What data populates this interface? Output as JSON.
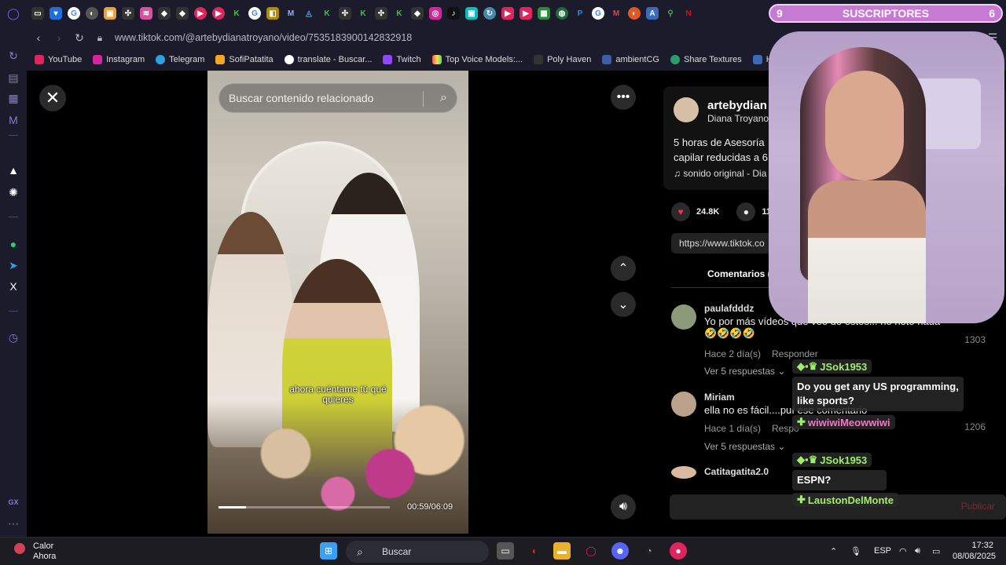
{
  "browser": {
    "url": "www.tiktok.com/@artebydianatroyano/video/7535183900142832918",
    "bookmarks": [
      "YouTube",
      "Instagram",
      "Telegram",
      "SofiPatatita",
      "translate - Buscar...",
      "Twitch",
      "Top Voice Models:...",
      "Poly Haven",
      "ambientCG",
      "Share Textures",
      "Ha"
    ]
  },
  "video": {
    "search_placeholder": "Buscar contenido relacionado",
    "subtitle": "ahora cuéntame tú qué\nquieres",
    "time": "00:59/06:09",
    "progress": 0.16
  },
  "post": {
    "username": "artebydian",
    "nickname": "Diana Troyano",
    "description_line1": "5 horas de Asesoría",
    "description_line2": "capilar reducidas a 6",
    "sound": "sonido original - Dia",
    "likes": "24.8K",
    "comments_count": "117",
    "link": "https://www.tiktok.co",
    "comments_tab": "Comentarios ("
  },
  "comments": [
    {
      "name": "paulafdddz",
      "text": "Yo por más vídeos que veo de estos... no noto nada",
      "emoji": "🤣🤣🤣🤣",
      "meta": "Hace 2 día(s)",
      "reply": "Responder",
      "more": "Ver 5 respuestas ⌄",
      "likes": "1303"
    },
    {
      "name": "Miriam",
      "text": "ella no es fácil....puí ese comentario",
      "meta": "Hace 1 día(s)",
      "reply": "Respo",
      "more": "Ver 5 respuestas ⌄",
      "likes": "1206"
    },
    {
      "name": "Catitagatita2.0"
    }
  ],
  "publish": "Publicar",
  "overlay": {
    "sub_left": "9",
    "sub_label": "SUSCRIPTORES",
    "sub_right": "6",
    "chat": [
      {
        "user": "JSok1953",
        "msg": "Do you get any US programming, like sports?"
      },
      {
        "user": "wiwiwiMeowwiwi",
        "msg": ""
      },
      {
        "user": "JSok1953",
        "msg": "ESPN?"
      },
      {
        "user": "LaustonDelMonte",
        "msg": ""
      }
    ]
  },
  "taskbar": {
    "weather_title": "Calor",
    "weather_sub": "Ahora",
    "search": "Buscar",
    "lang": "ESP",
    "time": "17:32",
    "date": "08/08/2025"
  },
  "sidebar_gx": "GX",
  "colors": {
    "accent": "#fe2c55",
    "overlay": "#c77ad3"
  }
}
